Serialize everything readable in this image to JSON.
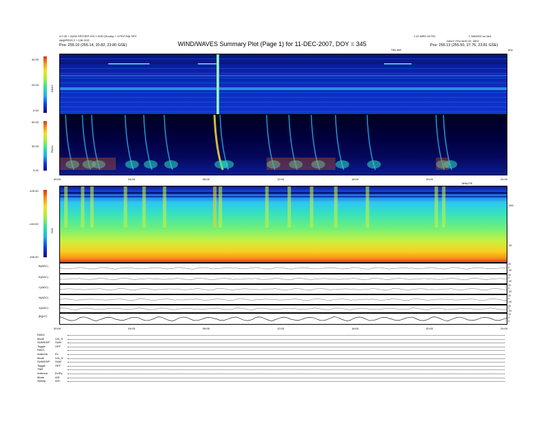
{
  "header": {
    "title": "WIND/WAVES Summary Plot (Page 1) for 11-DEC-2007, DOY = 345",
    "left_line1": "4.0 30 + 2(200 SPCSEP 200 1 SOD (Hourly) + 4 PEZ R@ SPC",
    "left_line2": "Alt@PRSS 2 + 135 OCE",
    "left_line3": "Pos: 255.10 (255.14, 20.82, 23.80 GSE)",
    "mid_label": "TIELINE",
    "right_line1": "1.10 WED 01/702",
    "right_line2": "DAILY THU AUG 02, 2002",
    "right_line3": "Pos: 255.13 (255.50, 27.76, 23.81 GSE)",
    "far_right_top": "L 3/8/2002 on dlo1",
    "far_right_sub": "kHz"
  },
  "rad2": {
    "ylabel": "RAD2",
    "ticks": [
      "40.00",
      "20.00",
      "0.00"
    ]
  },
  "rad1": {
    "ylabel": "RAD1",
    "ticks": [
      "60.00",
      "30.00",
      "0.00"
    ]
  },
  "time_axis": {
    "ticks": [
      "00:00",
      "04:00",
      "08:00",
      "12:00",
      "16:00",
      "20:00",
      "24:00"
    ],
    "label": "MINUTE"
  },
  "tnr": {
    "ylabel": "TNR",
    "ticks": [
      "-125.00",
      "-140.00",
      "-155.00"
    ],
    "right_ticks": [
      "100",
      "10"
    ]
  },
  "strips": [
    {
      "label": "B(ADC)",
      "right": [
        "20",
        "0",
        "-20"
      ]
    },
    {
      "label": "E(ADC)",
      "right": [
        "20",
        "0",
        "-20"
      ]
    },
    {
      "label": "C(ADC)",
      "right": [
        "20",
        "0",
        "-20"
      ]
    },
    {
      "label": "N(ADC)",
      "right": [
        "20",
        "0",
        "-20"
      ]
    },
    {
      "label": "X(ADC)",
      "right": [
        "20",
        "0",
        "-20"
      ]
    },
    {
      "label": "|B|(nT)",
      "right": [
        "10",
        "5",
        "0"
      ]
    }
  ],
  "bottom_axis": {
    "ticks": [
      "00:00",
      "04:00",
      "08:00",
      "12:00",
      "16:00",
      "20:00",
      "24:00"
    ]
  },
  "legend": [
    {
      "key": "RAD2",
      "val": ""
    },
    {
      "key": "Mode",
      "val": "LIN_S"
    },
    {
      "key": "SUM/DSP",
      "val": "SUM"
    },
    {
      "key": "Toggle",
      "val": "OFF"
    },
    {
      "key": "RAD1",
      "val": ""
    },
    {
      "key": "Antenna",
      "val": "Ex"
    },
    {
      "key": "Mode",
      "val": "LIN_S"
    },
    {
      "key": "SUM/DSP",
      "val": "SUM"
    },
    {
      "key": "Toggle",
      "val": "OFF"
    },
    {
      "key": "TNR",
      "val": ""
    },
    {
      "key": "Antenna",
      "val": "Ex/Ey"
    },
    {
      "key": "Mode",
      "val": "A/D"
    },
    {
      "key": "Sweep",
      "val": "A/D"
    }
  ],
  "chart_data": {
    "type": "heatmap",
    "title": "WIND/WAVES Summary Plot (Page 1) for 11-DEC-2007, DOY = 345",
    "x_range_hours": [
      0,
      24
    ],
    "panels": [
      {
        "name": "RAD2",
        "ylim": [
          0,
          40
        ],
        "ticks": [
          0,
          20,
          40
        ]
      },
      {
        "name": "RAD1",
        "ylim": [
          0,
          60
        ],
        "ticks": [
          0,
          30,
          60
        ]
      },
      {
        "name": "TNR",
        "ylim": [
          -155,
          -125
        ],
        "ticks": [
          -155,
          -140,
          -125
        ]
      }
    ],
    "bursts_hours": [
      0.3,
      1.2,
      1.7,
      3.5,
      4.5,
      5.6,
      8.3,
      8.6,
      11.1,
      12.3,
      13.5,
      14.8,
      16.5,
      20.2,
      20.6
    ],
    "intense_burst_hour": 8.3
  }
}
